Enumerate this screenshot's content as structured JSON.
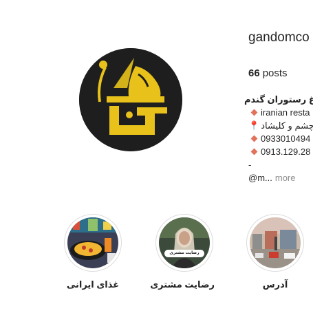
{
  "profile": {
    "username": "gandomco",
    "avatar_icon": "restaurant-logo-icon",
    "posts_count": "66",
    "posts_label": "posts"
  },
  "bio": {
    "name": "باغ رستوران گندم",
    "lines": [
      {
        "marker": "diamond",
        "text": "iranian resta"
      },
      {
        "marker": "pin",
        "text": "مشهد بلوار بزرگراه چشم و کلیشاد"
      },
      {
        "marker": "diamond",
        "text": "0933010494"
      },
      {
        "marker": "diamond",
        "text": "0913.129.28"
      }
    ],
    "dash": "-",
    "mention": "@m...",
    "more": "more"
  },
  "highlights": [
    {
      "label": "غذای ایرانی",
      "icon": "food-dish-thumbnail"
    },
    {
      "label": "رضایت مشتری",
      "icon": "customer-photo-thumbnail",
      "badge": "رضایت مشتری"
    },
    {
      "label": "آدرس",
      "icon": "street-view-thumbnail"
    }
  ],
  "colors": {
    "logo_yellow": "#e8c21a",
    "logo_bg": "#1e1e1e",
    "marker": "#e2725b",
    "muted": "#8e8e8e"
  }
}
